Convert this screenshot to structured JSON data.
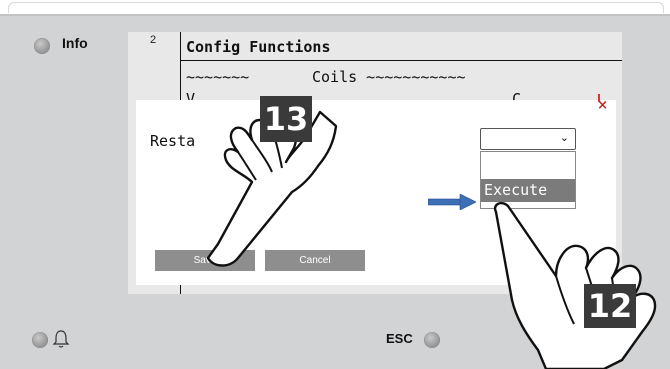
{
  "panel": {
    "info_label": "Info",
    "esc_label": "ESC"
  },
  "editor": {
    "line_number": "2",
    "header": "Config Functions",
    "line_coils_left": "~~~~~~~",
    "line_coils_right": "Coils ~~~~~~~~~~~",
    "line_partial_left": "V",
    "line_partial_right": "C"
  },
  "dialog": {
    "close_glyph": "×",
    "label_partial": "Resta",
    "select_value": "",
    "options": [
      "",
      "Execute"
    ],
    "highlighted_option": "Execute",
    "save_label": "Save",
    "cancel_label": "Cancel"
  },
  "annotations": {
    "step_13": "13",
    "step_12": "12"
  },
  "colors": {
    "bezel": "#d2d3d4",
    "arrow_blue": "#3d6fb6",
    "close_red": "#c02828",
    "button_gray": "#8e8e8e"
  }
}
